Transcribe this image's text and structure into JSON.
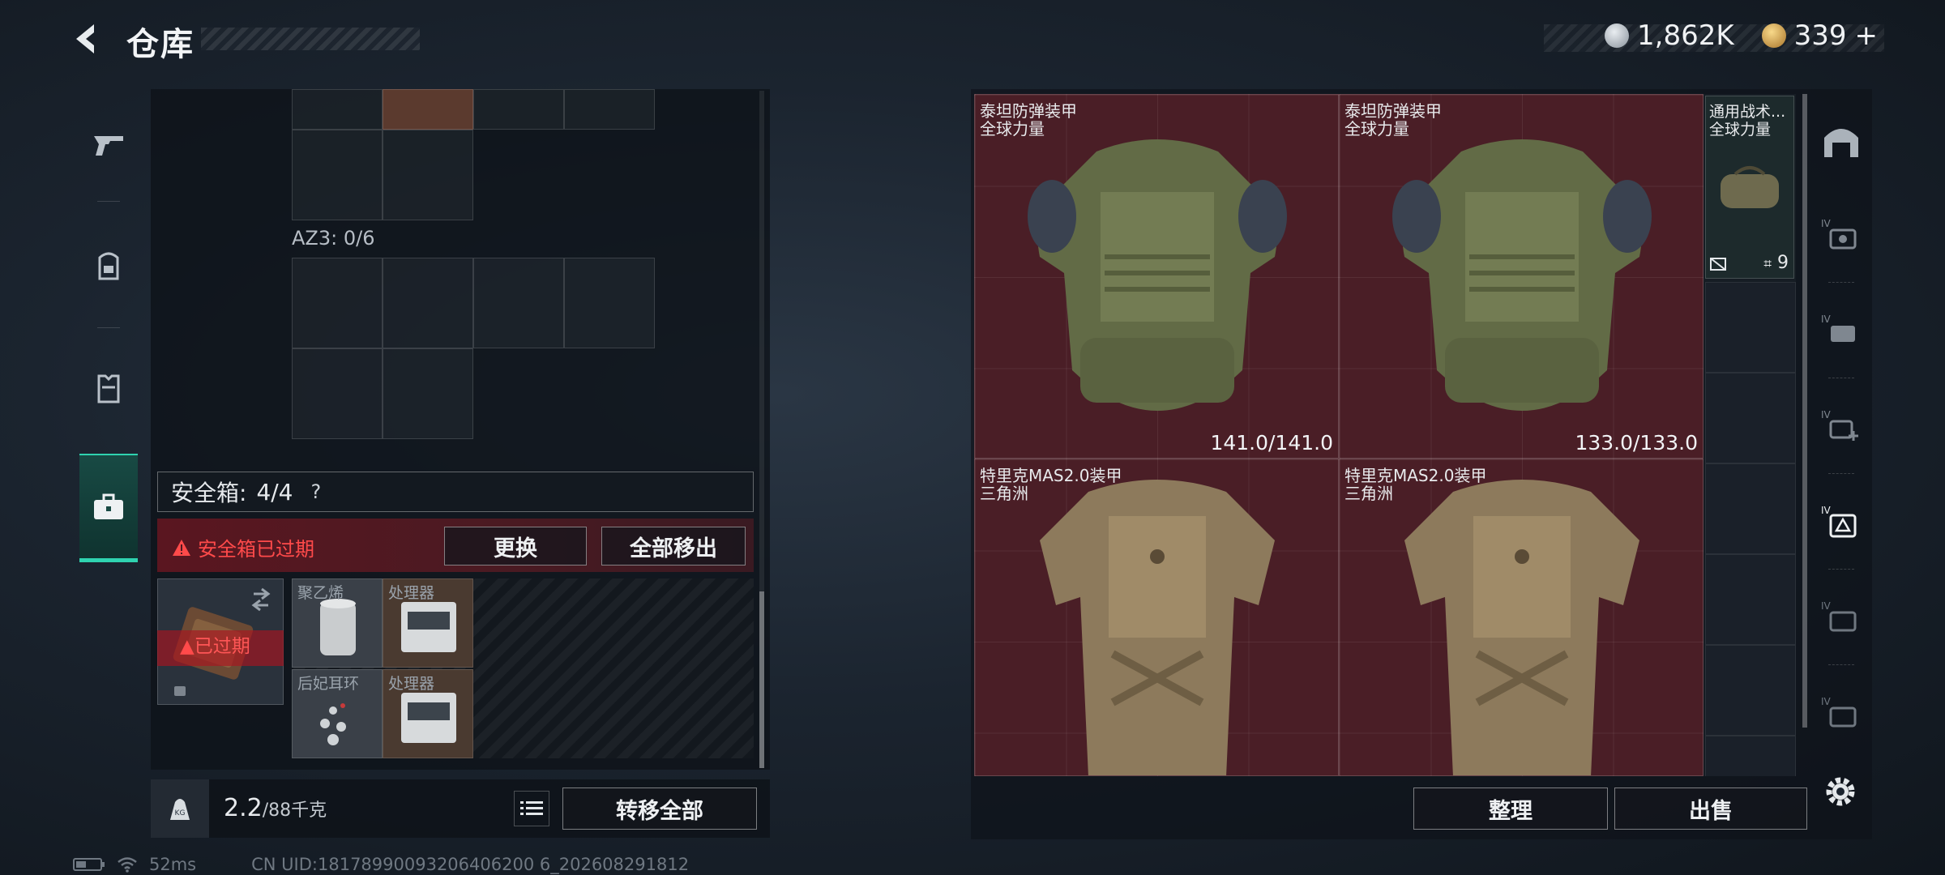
{
  "header": {
    "title": "仓库",
    "currency": [
      {
        "icon": "silver-coin-icon",
        "value": "1,862K"
      },
      {
        "icon": "gold-coin-icon",
        "value": "339"
      }
    ],
    "add_label": "+"
  },
  "left_tabs": [
    {
      "icon": "pistol-icon",
      "active": false
    },
    {
      "icon": "backpack-icon",
      "active": false
    },
    {
      "icon": "vest-icon",
      "active": false
    },
    {
      "icon": "briefcase-icon",
      "active": true
    }
  ],
  "inventory": {
    "az3_label": "AZ3: 0/6"
  },
  "safebox": {
    "label": "安全箱:",
    "count": "4/4",
    "help": "?",
    "expired_notice": "安全箱已过期",
    "replace_label": "更换",
    "move_all_out_label": "全部移出",
    "case_expired": "已过期",
    "items": [
      {
        "name": "聚乙烯"
      },
      {
        "name": "处理器"
      },
      {
        "name": "后妃耳环"
      },
      {
        "name": "处理器"
      }
    ]
  },
  "footer_left": {
    "weight_value": "2.2",
    "weight_max": "/88千克",
    "transfer_all_label": "转移全部"
  },
  "status_bar": {
    "ping": "52ms",
    "uid": "CN UID:18178990093206406200 6_202608291812"
  },
  "stash": {
    "items": [
      {
        "name": "泰坦防弹装甲",
        "faction": "全球力量",
        "durability": "141.0/141.0"
      },
      {
        "name": "泰坦防弹装甲",
        "faction": "全球力量",
        "durability": "133.0/133.0"
      },
      {
        "name": "特里克MAS2.0装甲",
        "faction": "三角洲"
      },
      {
        "name": "特里克MAS2.0装甲",
        "faction": "三角洲"
      }
    ],
    "bag": {
      "name": "通用战术...",
      "faction": "全球力量",
      "count": "9"
    }
  },
  "footer_right": {
    "sort_label": "整理",
    "sell_label": "出售"
  },
  "colors": {
    "accent": "#2fd3b0",
    "danger": "#ff4a4a",
    "item_bg": "#4a1e26"
  }
}
